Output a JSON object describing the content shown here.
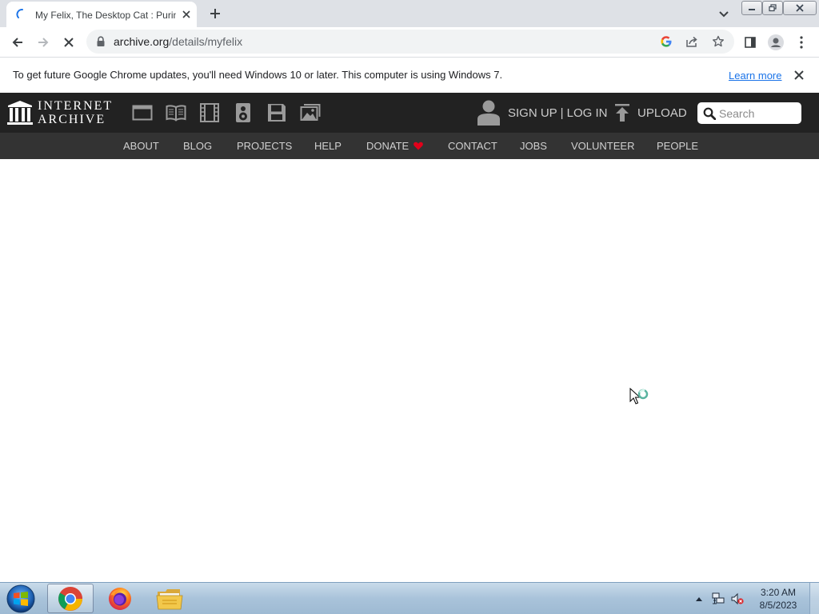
{
  "browser": {
    "tab": {
      "title": "My Felix, The Desktop Cat : Purin"
    },
    "address": {
      "host": "archive.org",
      "path": "/details/myfelix"
    },
    "infobar": {
      "message": "To get future Google Chrome updates, you'll need Windows 10 or later. This computer is using Windows 7.",
      "link": "Learn more"
    }
  },
  "ia": {
    "wordmark": {
      "line1": "INTERNET",
      "line2": "ARCHIVE"
    },
    "media_icons": [
      "web-icon",
      "texts-icon",
      "video-icon",
      "audio-icon",
      "software-icon",
      "images-icon"
    ],
    "auth": {
      "signup": "SIGN UP",
      "separator": " | ",
      "login": "LOG IN"
    },
    "upload": "UPLOAD",
    "search": {
      "placeholder": "Search"
    },
    "nav": [
      "ABOUT",
      "BLOG",
      "PROJECTS",
      "HELP",
      "DONATE",
      "CONTACT",
      "JOBS",
      "VOLUNTEER",
      "PEOPLE"
    ]
  },
  "taskbar": {
    "apps": [
      "chrome",
      "firefox",
      "file-explorer"
    ],
    "active_app": "chrome",
    "clock": {
      "time": "3:20 AM",
      "date": "8/5/2023"
    }
  },
  "colors": {
    "ia_header": "#222222",
    "ia_nav": "#333333",
    "donate_heart": "#e2001a",
    "link_blue": "#1a73e8",
    "tab_strip": "#dee1e6"
  }
}
